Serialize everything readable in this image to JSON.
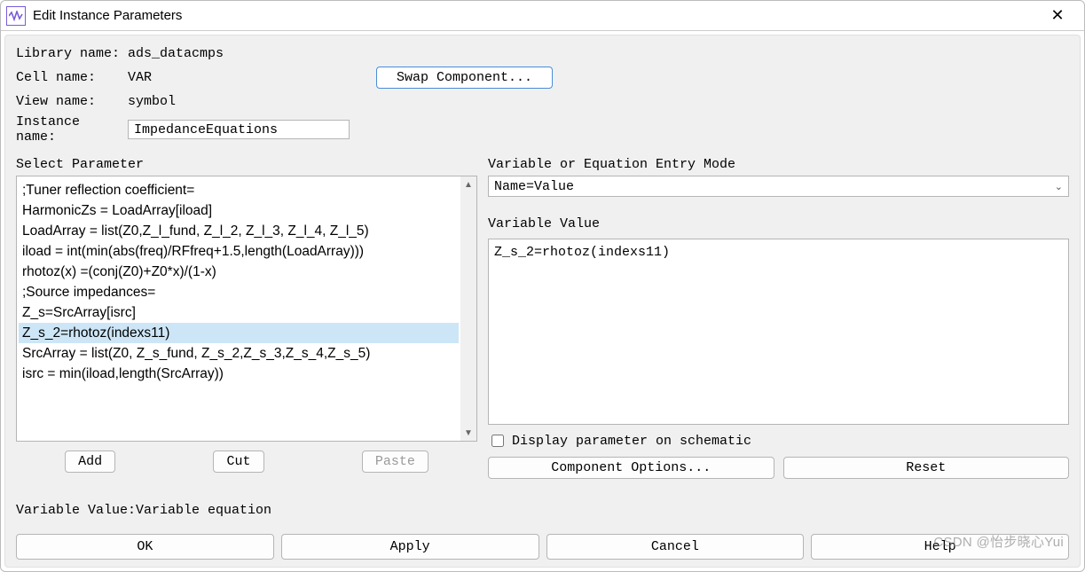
{
  "title": "Edit Instance Parameters",
  "meta": {
    "library_label": "Library name:",
    "library_value": "ads_datacmps",
    "cell_label": "Cell name:",
    "cell_value": "VAR",
    "view_label": "View name:",
    "view_value": "symbol",
    "instance_label": "Instance name:",
    "instance_value": "ImpedanceEquations",
    "swap_label": "Swap Component..."
  },
  "left": {
    "header": "Select Parameter",
    "items": [
      ";Tuner reflection coefficient=",
      "HarmonicZs = LoadArray[iload]",
      "LoadArray = list(Z0,Z_l_fund, Z_l_2, Z_l_3, Z_l_4, Z_l_5)",
      "iload = int(min(abs(freq)/RFfreq+1.5,length(LoadArray)))",
      "rhotoz(x) =(conj(Z0)+Z0*x)/(1-x)",
      ";Source impedances=",
      "Z_s=SrcArray[isrc]",
      "Z_s_2=rhotoz(indexs11)",
      "SrcArray = list(Z0, Z_s_fund, Z_s_2,Z_s_3,Z_s_4,Z_s_5)",
      "isrc = min(iload,length(SrcArray))"
    ],
    "selected_index": 7,
    "add_label": "Add",
    "cut_label": "Cut",
    "paste_label": "Paste"
  },
  "right": {
    "entry_mode_label": "Variable or Equation Entry Mode",
    "entry_mode_value": "Name=Value",
    "variable_value_label": "Variable Value",
    "variable_value": "Z_s_2=rhotoz(indexs11)",
    "display_label": "Display parameter on schematic",
    "display_checked": false,
    "component_options_label": "Component Options...",
    "reset_label": "Reset"
  },
  "hint": "Variable Value:Variable equation",
  "bottom": {
    "ok": "OK",
    "apply": "Apply",
    "cancel": "Cancel",
    "help": "Help"
  },
  "watermark": "CSDN @怡步晓心Yui"
}
